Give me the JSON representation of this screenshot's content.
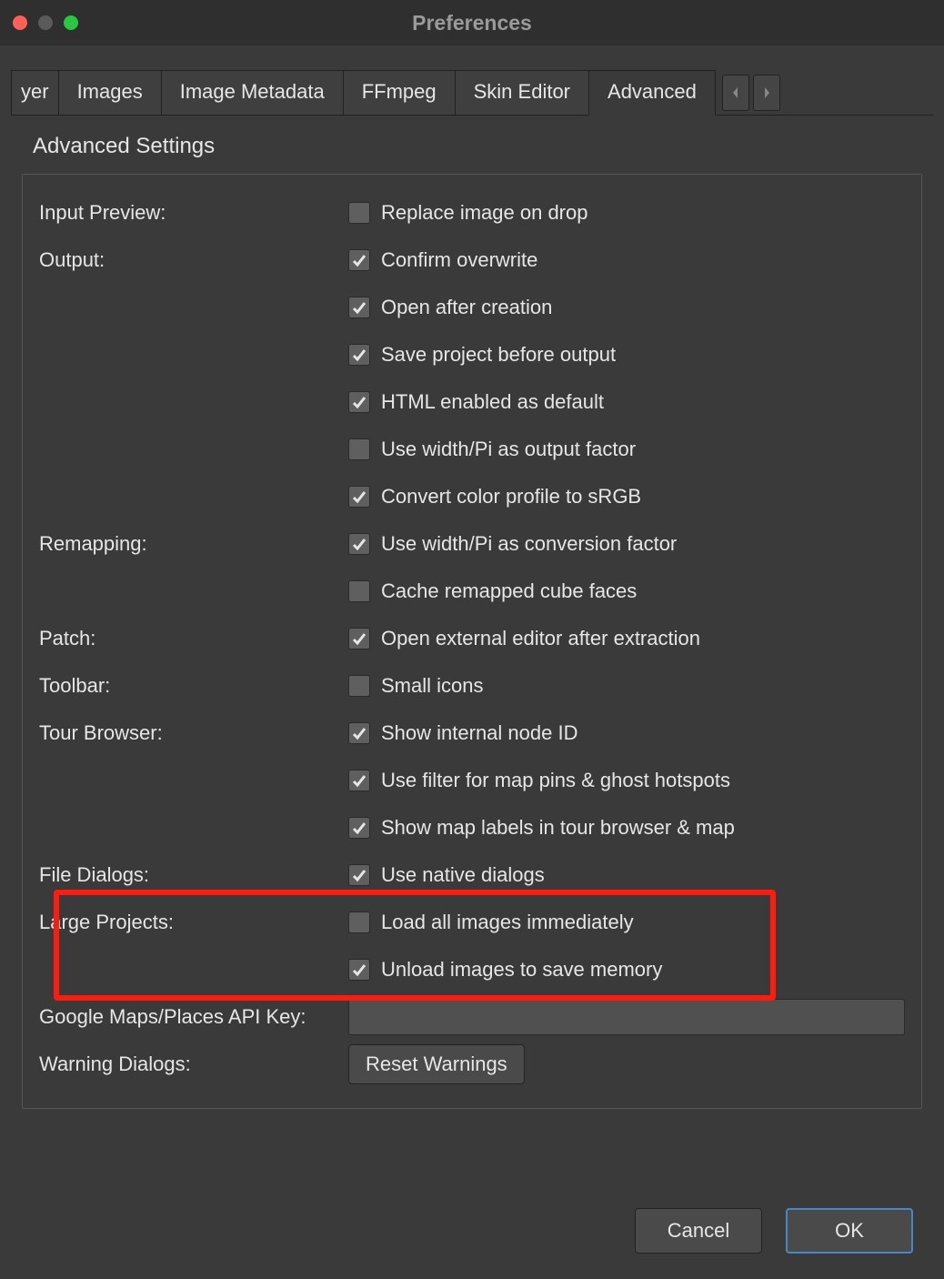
{
  "window": {
    "title": "Preferences"
  },
  "tabs": {
    "frag": "yer",
    "t1": "Images",
    "t2": "Image Metadata",
    "t3": "FFmpeg",
    "t4": "Skin Editor",
    "t5": "Advanced"
  },
  "section_title": "Advanced Settings",
  "labels": {
    "input_preview": "Input Preview:",
    "output": "Output:",
    "remapping": "Remapping:",
    "patch": "Patch:",
    "toolbar": "Toolbar:",
    "tour_browser": "Tour Browser:",
    "file_dialogs": "File Dialogs:",
    "large_projects": "Large Projects:",
    "api_key": "Google Maps/Places API Key:",
    "warning_dialogs": "Warning Dialogs:"
  },
  "options": {
    "replace_drop": {
      "label": "Replace image on drop",
      "checked": false
    },
    "confirm_overwrite": {
      "label": "Confirm overwrite",
      "checked": true
    },
    "open_after": {
      "label": "Open after creation",
      "checked": true
    },
    "save_before": {
      "label": "Save project before output",
      "checked": true
    },
    "html_default": {
      "label": "HTML enabled as default",
      "checked": true
    },
    "width_pi_out": {
      "label": "Use width/Pi as output factor",
      "checked": false
    },
    "convert_srgb": {
      "label": "Convert color profile to sRGB",
      "checked": true
    },
    "width_pi_conv": {
      "label": "Use width/Pi as conversion factor",
      "checked": true
    },
    "cache_cube": {
      "label": "Cache remapped cube faces",
      "checked": false
    },
    "open_editor": {
      "label": "Open external editor after extraction",
      "checked": true
    },
    "small_icons": {
      "label": "Small icons",
      "checked": false
    },
    "show_node_id": {
      "label": "Show internal node ID",
      "checked": true
    },
    "filter_pins": {
      "label": "Use filter for map pins & ghost hotspots",
      "checked": true
    },
    "show_map_labels": {
      "label": "Show map labels in tour browser & map",
      "checked": true
    },
    "native_dialogs": {
      "label": "Use native dialogs",
      "checked": true
    },
    "load_all": {
      "label": "Load all images immediately",
      "checked": false
    },
    "unload_images": {
      "label": "Unload images to save memory",
      "checked": true
    }
  },
  "api_key_value": "",
  "buttons": {
    "reset_warnings": "Reset Warnings",
    "cancel": "Cancel",
    "ok": "OK"
  }
}
